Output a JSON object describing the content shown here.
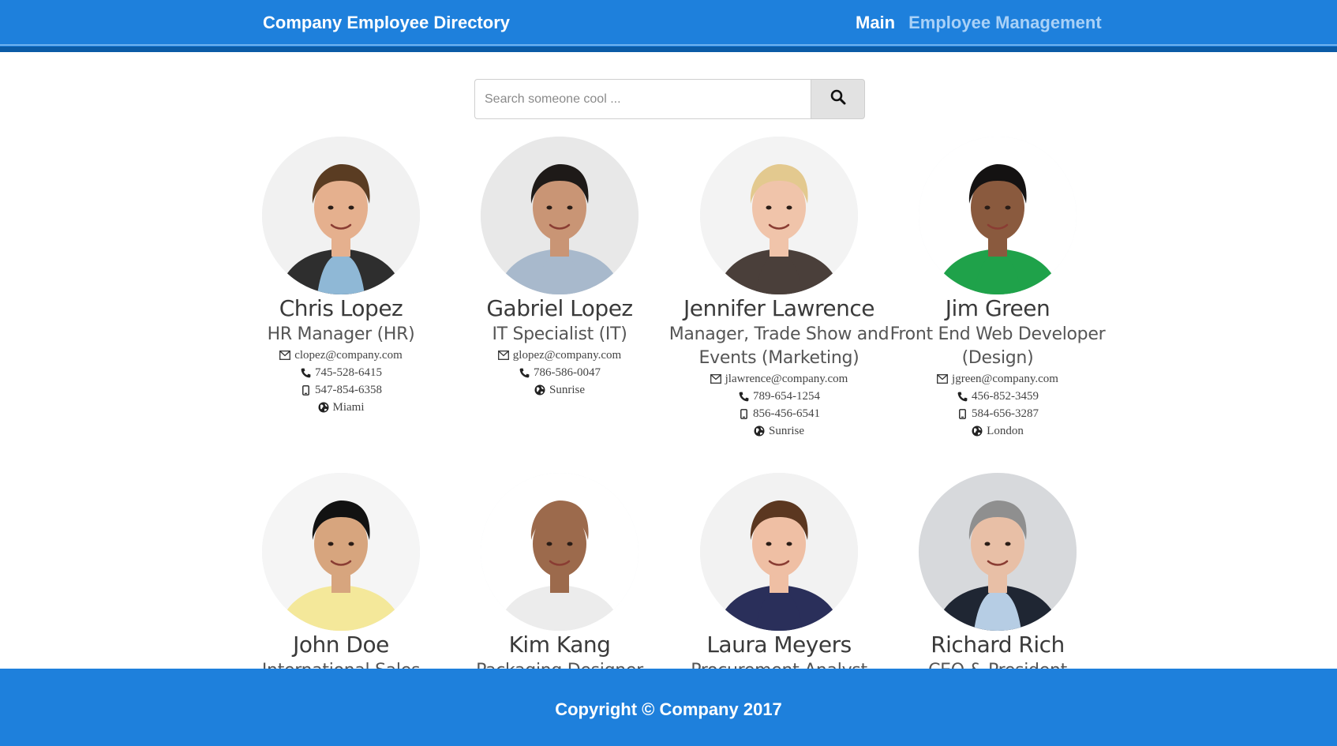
{
  "navbar": {
    "brand": "Company Employee Directory",
    "links": [
      {
        "label": "Main"
      },
      {
        "label": "Employee Management"
      }
    ]
  },
  "search": {
    "placeholder": "Search someone cool ...",
    "button_icon": "search-icon"
  },
  "employees": [
    {
      "name": "Chris Lopez",
      "title": "HR Manager (HR)",
      "email": "clopez@company.com",
      "phone": "745-528-6415",
      "mobile": "547-854-6358",
      "location": "Miami",
      "photo": {
        "bg": "#f1f1f1",
        "skin": "#e5b08e",
        "hair": "#5a3c22",
        "shirt": "#8fb8d6",
        "jacket": "#2e2e2e"
      }
    },
    {
      "name": "Gabriel Lopez",
      "title": "IT Specialist (IT)",
      "email": "glopez@company.com",
      "phone": "786-586-0047",
      "location": "Sunrise",
      "photo": {
        "bg": "#e8e8e8",
        "skin": "#c99575",
        "hair": "#1e1a18",
        "shirt": "#a8b9cc",
        "jacket": "#a8b9cc"
      }
    },
    {
      "name": "Jennifer Lawrence",
      "title": "Manager, Trade Show and Events (Marketing)",
      "email": "jlawrence@company.com",
      "phone": "789-654-1254",
      "mobile": "856-456-6541",
      "location": "Sunrise",
      "photo": {
        "bg": "#f3f3f3",
        "skin": "#f0c4aa",
        "hair": "#e3c98f",
        "shirt": "#4a3f3a",
        "jacket": "#4a3f3a"
      }
    },
    {
      "name": "Jim Green",
      "title": "Front End Web Developer (Design)",
      "email": "jgreen@company.com",
      "phone": "456-852-3459",
      "mobile": "584-656-3287",
      "location": "London",
      "photo": {
        "bg": "#ffffff",
        "skin": "#8a5a3e",
        "hair": "#141212",
        "shirt": "#1fa24a",
        "jacket": "#1fa24a"
      }
    },
    {
      "name": "John Doe",
      "title": "International Sales",
      "photo": {
        "bg": "#f5f5f5",
        "skin": "#d7a57e",
        "hair": "#121212",
        "shirt": "#f4e89a",
        "jacket": "#f4e89a"
      }
    },
    {
      "name": "Kim Kang",
      "title": "Packaging Designer",
      "photo": {
        "bg": "#ffffff",
        "skin": "#9c6a4c",
        "hair": "#9c6a4c",
        "shirt": "#ececec",
        "jacket": "#ececec"
      }
    },
    {
      "name": "Laura Meyers",
      "title": "Procurement Analyst",
      "photo": {
        "bg": "#f2f2f2",
        "skin": "#efbfa4",
        "hair": "#5b3720",
        "shirt": "#2a2f5a",
        "jacket": "#2a2f5a"
      }
    },
    {
      "name": "Richard Rich",
      "title": "CEO & President",
      "photo": {
        "bg": "#d7d9dc",
        "skin": "#e8bfa6",
        "hair": "#8f8f8f",
        "shirt": "#b6cde4",
        "jacket": "#1f2633"
      }
    }
  ],
  "footer": {
    "copyright": "Copyright © Company 2017"
  },
  "colors": {
    "primary": "#1e80dc",
    "primary_dark": "#0b5ba6",
    "nav_muted": "#a9d1f7"
  }
}
